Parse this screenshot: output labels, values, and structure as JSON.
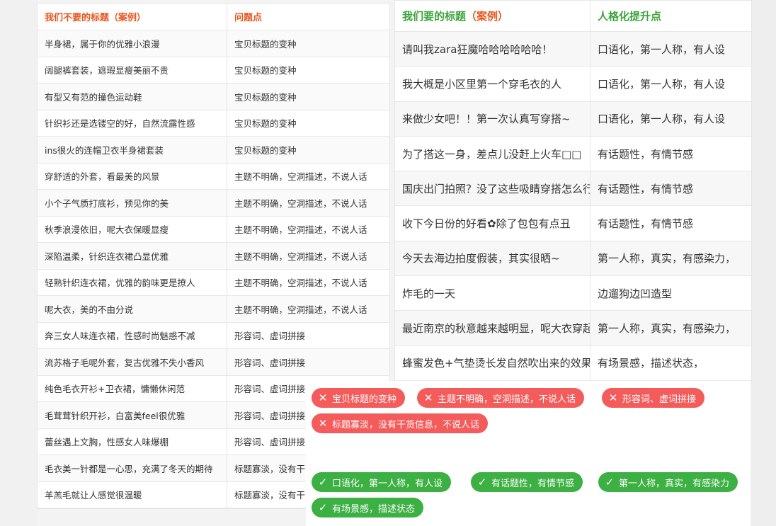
{
  "left_table": {
    "headers": [
      "我们不要的标题（案例）",
      "问题点"
    ],
    "rows": [
      [
        "半身裙，属于你的优雅小浪漫",
        "宝贝标题的变种"
      ],
      [
        "阔腿裤套装，遮瑕显瘦美丽不贵",
        "宝贝标题的变种"
      ],
      [
        "有型又有范的撞色运动鞋",
        "宝贝标题的变种"
      ],
      [
        "针织衫还是选镂空的好，自然流露性感",
        "宝贝标题的变种"
      ],
      [
        "ins很火的连帽卫衣半身裙套装",
        "宝贝标题的变种"
      ],
      [
        "穿舒适的外套，看最美的风景",
        "主题不明确，空洞描述，不说人话"
      ],
      [
        "小个子气质打底衫，预见你的美",
        "主题不明确，空洞描述，不说人话"
      ],
      [
        "秋季浪漫依旧，呢大衣保暖显瘦",
        "主题不明确，空洞描述，不说人话"
      ],
      [
        "深陷温柔，针织连衣裙凸显优雅",
        "主题不明确，空洞描述，不说人话"
      ],
      [
        "轻熟针织连衣裙，优雅的韵味更是撩人",
        "主题不明确，空洞描述，不说人话"
      ],
      [
        "呢大衣，美的不由分说",
        "主题不明确，空洞描述，不说人话"
      ],
      [
        "奔三女人味连衣裙，性感时尚魅惑不减",
        "形容词、虚词拼接"
      ],
      [
        "流苏格子毛呢外套，复古优雅不失小香风",
        "形容词、虚词拼接"
      ],
      [
        "纯色毛衣开衫+卫衣裙，慵懒休闲范",
        "形容词、虚词拼接"
      ],
      [
        "毛茸茸针织开衫，白富美feel很优雅",
        "形容词、虚词拼接"
      ],
      [
        "蕾丝遇上文胸，性感女人味爆棚",
        "形容词、虚词拼接"
      ],
      [
        "毛衣美一针都是一心思，充满了冬天的期待",
        "标题寡淡，没有干"
      ],
      [
        "羊羔毛就让人感觉很温暖",
        "标题寡淡，没有干"
      ]
    ]
  },
  "right_table": {
    "header_prefix": "我们要的标题",
    "header_suffix": "（案例）",
    "header_col2": "人格化提升点",
    "rows": [
      [
        "请叫我zara狂魔哈哈哈哈哈哈！",
        "口语化，第一人称，有人设"
      ],
      [
        "我大概是小区里第一个穿毛衣的人",
        "口语化，第一人称，有人设"
      ],
      [
        "来做少女吧！！第一次认真写穿搭~",
        "口语化，第一人称，有人设"
      ],
      [
        "为了搭这一身，差点儿没赶上火车□□",
        "有话题性，有情节感"
      ],
      [
        "国庆出门拍照？没了这些吸睛穿搭怎么行？",
        "有话题性，有情节感"
      ],
      [
        "收下今日份的好看✿除了包包有点丑",
        "有话题性，有情节感"
      ],
      [
        "今天去海边拍度假装，其实很晒~",
        "第一人称，真实，有感染力，"
      ],
      [
        "炸毛的一天",
        "边遛狗边凹造型"
      ],
      [
        "最近南京的秋意越来越明显，呢大衣穿起来",
        "第一人称，真实，有感染力，"
      ],
      [
        "蜂蜜发色+气垫烫长发自然吹出来的效果",
        "有场景感，描述状态，"
      ]
    ]
  },
  "tags": {
    "bad": [
      "宝贝标题的变种",
      "主题不明确，空洞描述，不说人话",
      "形容词、虚词拼接",
      "标题寡淡，没有干货信息，不说人话"
    ],
    "good": [
      "口语化，第一人称，有人设",
      "有话题性，有情节感",
      "第一人称，真实，有感染力",
      "有场景感，描述状态"
    ],
    "bad_icon": "cross-icon",
    "good_icon": "check-icon"
  },
  "colors": {
    "orange_header": "#e8541e",
    "green_header": "#3aa33a",
    "red_tag": "#f45b5b",
    "green_tag": "#3cb043"
  }
}
